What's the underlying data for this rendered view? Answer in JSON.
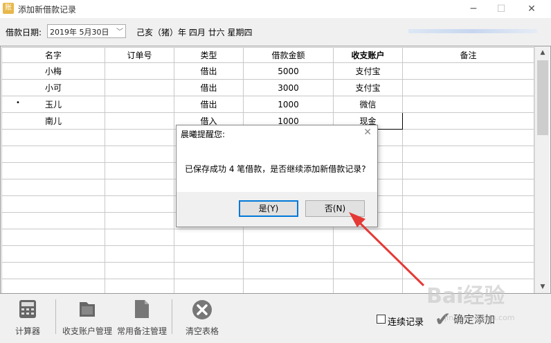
{
  "window": {
    "title": "添加新借款记录",
    "minimize_icon": "minus",
    "maximize_icon": "square",
    "close_icon": "x"
  },
  "toolbar": {
    "date_label": "借款日期:",
    "date_value": "2019年 5月30日",
    "lunar_text": "己亥（猪）年 四月 廿六 星期四"
  },
  "grid": {
    "headers": [
      "名字",
      "订单号",
      "类型",
      "借款金额",
      "收支账户",
      "备注"
    ],
    "rows": [
      {
        "name": "小梅",
        "order": "",
        "type": "借出",
        "amount": "5000",
        "account": "支付宝",
        "note": ""
      },
      {
        "name": "小可",
        "order": "",
        "type": "借出",
        "amount": "3000",
        "account": "支付宝",
        "note": ""
      },
      {
        "name": "玉儿",
        "order": "",
        "type": "借出",
        "amount": "1000",
        "account": "微信",
        "note": ""
      },
      {
        "name": "南儿",
        "order": "",
        "type": "借入",
        "amount": "1000",
        "account": "现金",
        "note": ""
      }
    ],
    "row_marker": "•"
  },
  "bottom": {
    "calculator": "计算器",
    "account_mgmt": "收支账户管理",
    "note_mgmt": "常用备注管理",
    "clear_table": "清空表格",
    "continuous": "连续记录",
    "confirm": "确定添加"
  },
  "dialog": {
    "title": "晨曦提醒您:",
    "message": "已保存成功 4 笔借款，是否继续添加新借款记录?",
    "yes": "是(Y)",
    "no": "否(N)"
  },
  "watermark": {
    "text": "Bai经验",
    "url": "jingyan.baidu.com"
  },
  "colors": {
    "accent": "#0078d7",
    "arrow": "#e53935"
  }
}
